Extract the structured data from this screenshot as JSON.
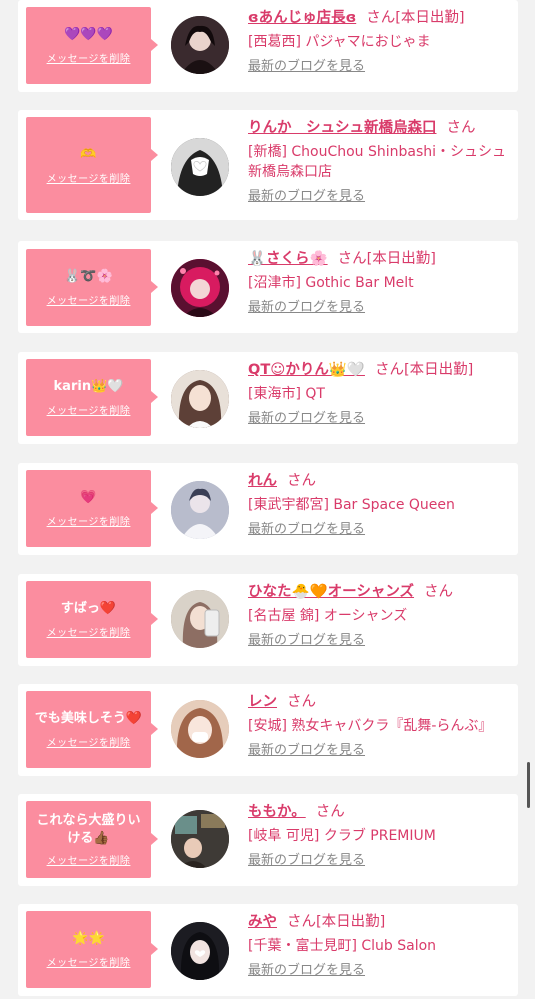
{
  "colors": {
    "background": "#f2f2f2",
    "bubble": "#fb8d9f",
    "accent_text": "#d93b6a",
    "blog_link": "#888888"
  },
  "entries": [
    {
      "message": "💜💜💜",
      "delete_label": "メッセージを削除",
      "name": "ɞあんじゅ店長ɞ",
      "honorific": "さん",
      "status": "[本日出勤]",
      "shop": "[西葛西] パジャマにおじゃま",
      "blog_label": "最新のブログを見る",
      "avatar_icon": "portrait-icon",
      "avatar_color": "#3a2a2e"
    },
    {
      "message": "🫶",
      "delete_label": "メッセージを削除",
      "name": "りんか　シュシュ新橋烏森口",
      "honorific": "さん",
      "status": "",
      "shop": "[新橋] ChouChou Shinbashi・シュシュ新橋烏森口店",
      "blog_label": "最新のブログを見る",
      "avatar_icon": "portrait-icon",
      "avatar_color": "#2b2b2b"
    },
    {
      "message": "🐰➰🌸",
      "delete_label": "メッセージを削除",
      "name": "🐰さくら🌸",
      "honorific": "さん",
      "status": "[本日出勤]",
      "shop": "[沼津市] Gothic Bar Melt",
      "blog_label": "最新のブログを見る",
      "avatar_icon": "portrait-icon",
      "avatar_color": "#c2185b"
    },
    {
      "message": "karin👑🤍",
      "delete_label": "メッセージを削除",
      "name": "QT☺︎かりん👑🤍",
      "honorific": "さん",
      "status": "[本日出勤]",
      "shop": "[東海市] QT",
      "blog_label": "最新のブログを見る",
      "avatar_icon": "portrait-icon",
      "avatar_color": "#6d4c41"
    },
    {
      "message": "💗",
      "delete_label": "メッセージを削除",
      "name": "れん",
      "honorific": "さん",
      "status": "",
      "shop": "[東武宇都宮] Bar Space Queen",
      "blog_label": "最新のブログを見る",
      "avatar_icon": "portrait-icon",
      "avatar_color": "#9aa0b8"
    },
    {
      "message": "すばっ❤️",
      "delete_label": "メッセージを削除",
      "name": "ひなた🐣🧡オーシャンズ",
      "honorific": "さん",
      "status": "",
      "shop": "[名古屋 錦] オーシャンズ",
      "blog_label": "最新のブログを見る",
      "avatar_icon": "portrait-icon",
      "avatar_color": "#a08a7a"
    },
    {
      "message": "でも美味しそう❤️",
      "delete_label": "メッセージを削除",
      "name": "レン",
      "honorific": "さん",
      "status": "",
      "shop": "[安城] 熟女キャバクラ『乱舞-らんぶ』",
      "blog_label": "最新のブログを見る",
      "avatar_icon": "portrait-icon",
      "avatar_color": "#c8a48a"
    },
    {
      "message": "これなら大盛りいける👍🏾",
      "delete_label": "メッセージを削除",
      "name": "ももか。",
      "honorific": "さん",
      "status": "",
      "shop": "[岐阜 可児] クラブ PREMIUM",
      "blog_label": "最新のブログを見る",
      "avatar_icon": "portrait-icon",
      "avatar_color": "#4a3b30"
    },
    {
      "message": "🌟🌟",
      "delete_label": "メッセージを削除",
      "name": "みや",
      "honorific": "さん",
      "status": "[本日出勤]",
      "shop": "[千葉・富士見町] Club Salon",
      "blog_label": "最新のブログを見る",
      "avatar_icon": "portrait-icon",
      "avatar_color": "#222222"
    }
  ]
}
